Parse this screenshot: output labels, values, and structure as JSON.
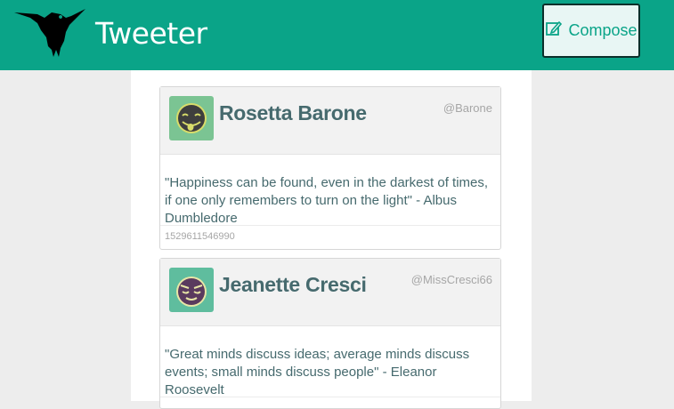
{
  "header": {
    "app_title": "Tweeter",
    "compose_label": "Compose",
    "brand_color": "#0aa488"
  },
  "tweets": [
    {
      "name": "Rosetta Barone",
      "handle": "@Barone",
      "text": "\"Happiness can be found, even in the darkest of times, if one only remembers to turn on the light\" - Albus Dumbledore",
      "timestamp": "1529611546990",
      "avatar_icon": "tongue-out-face-icon"
    },
    {
      "name": "Jeanette Cresci",
      "handle": "@MissCresci66",
      "text": "\"Great minds discuss ideas; average minds discuss events; small minds discuss people\" - Eleanor Roosevelt",
      "timestamp": "",
      "avatar_icon": "sleepy-face-icon"
    }
  ]
}
